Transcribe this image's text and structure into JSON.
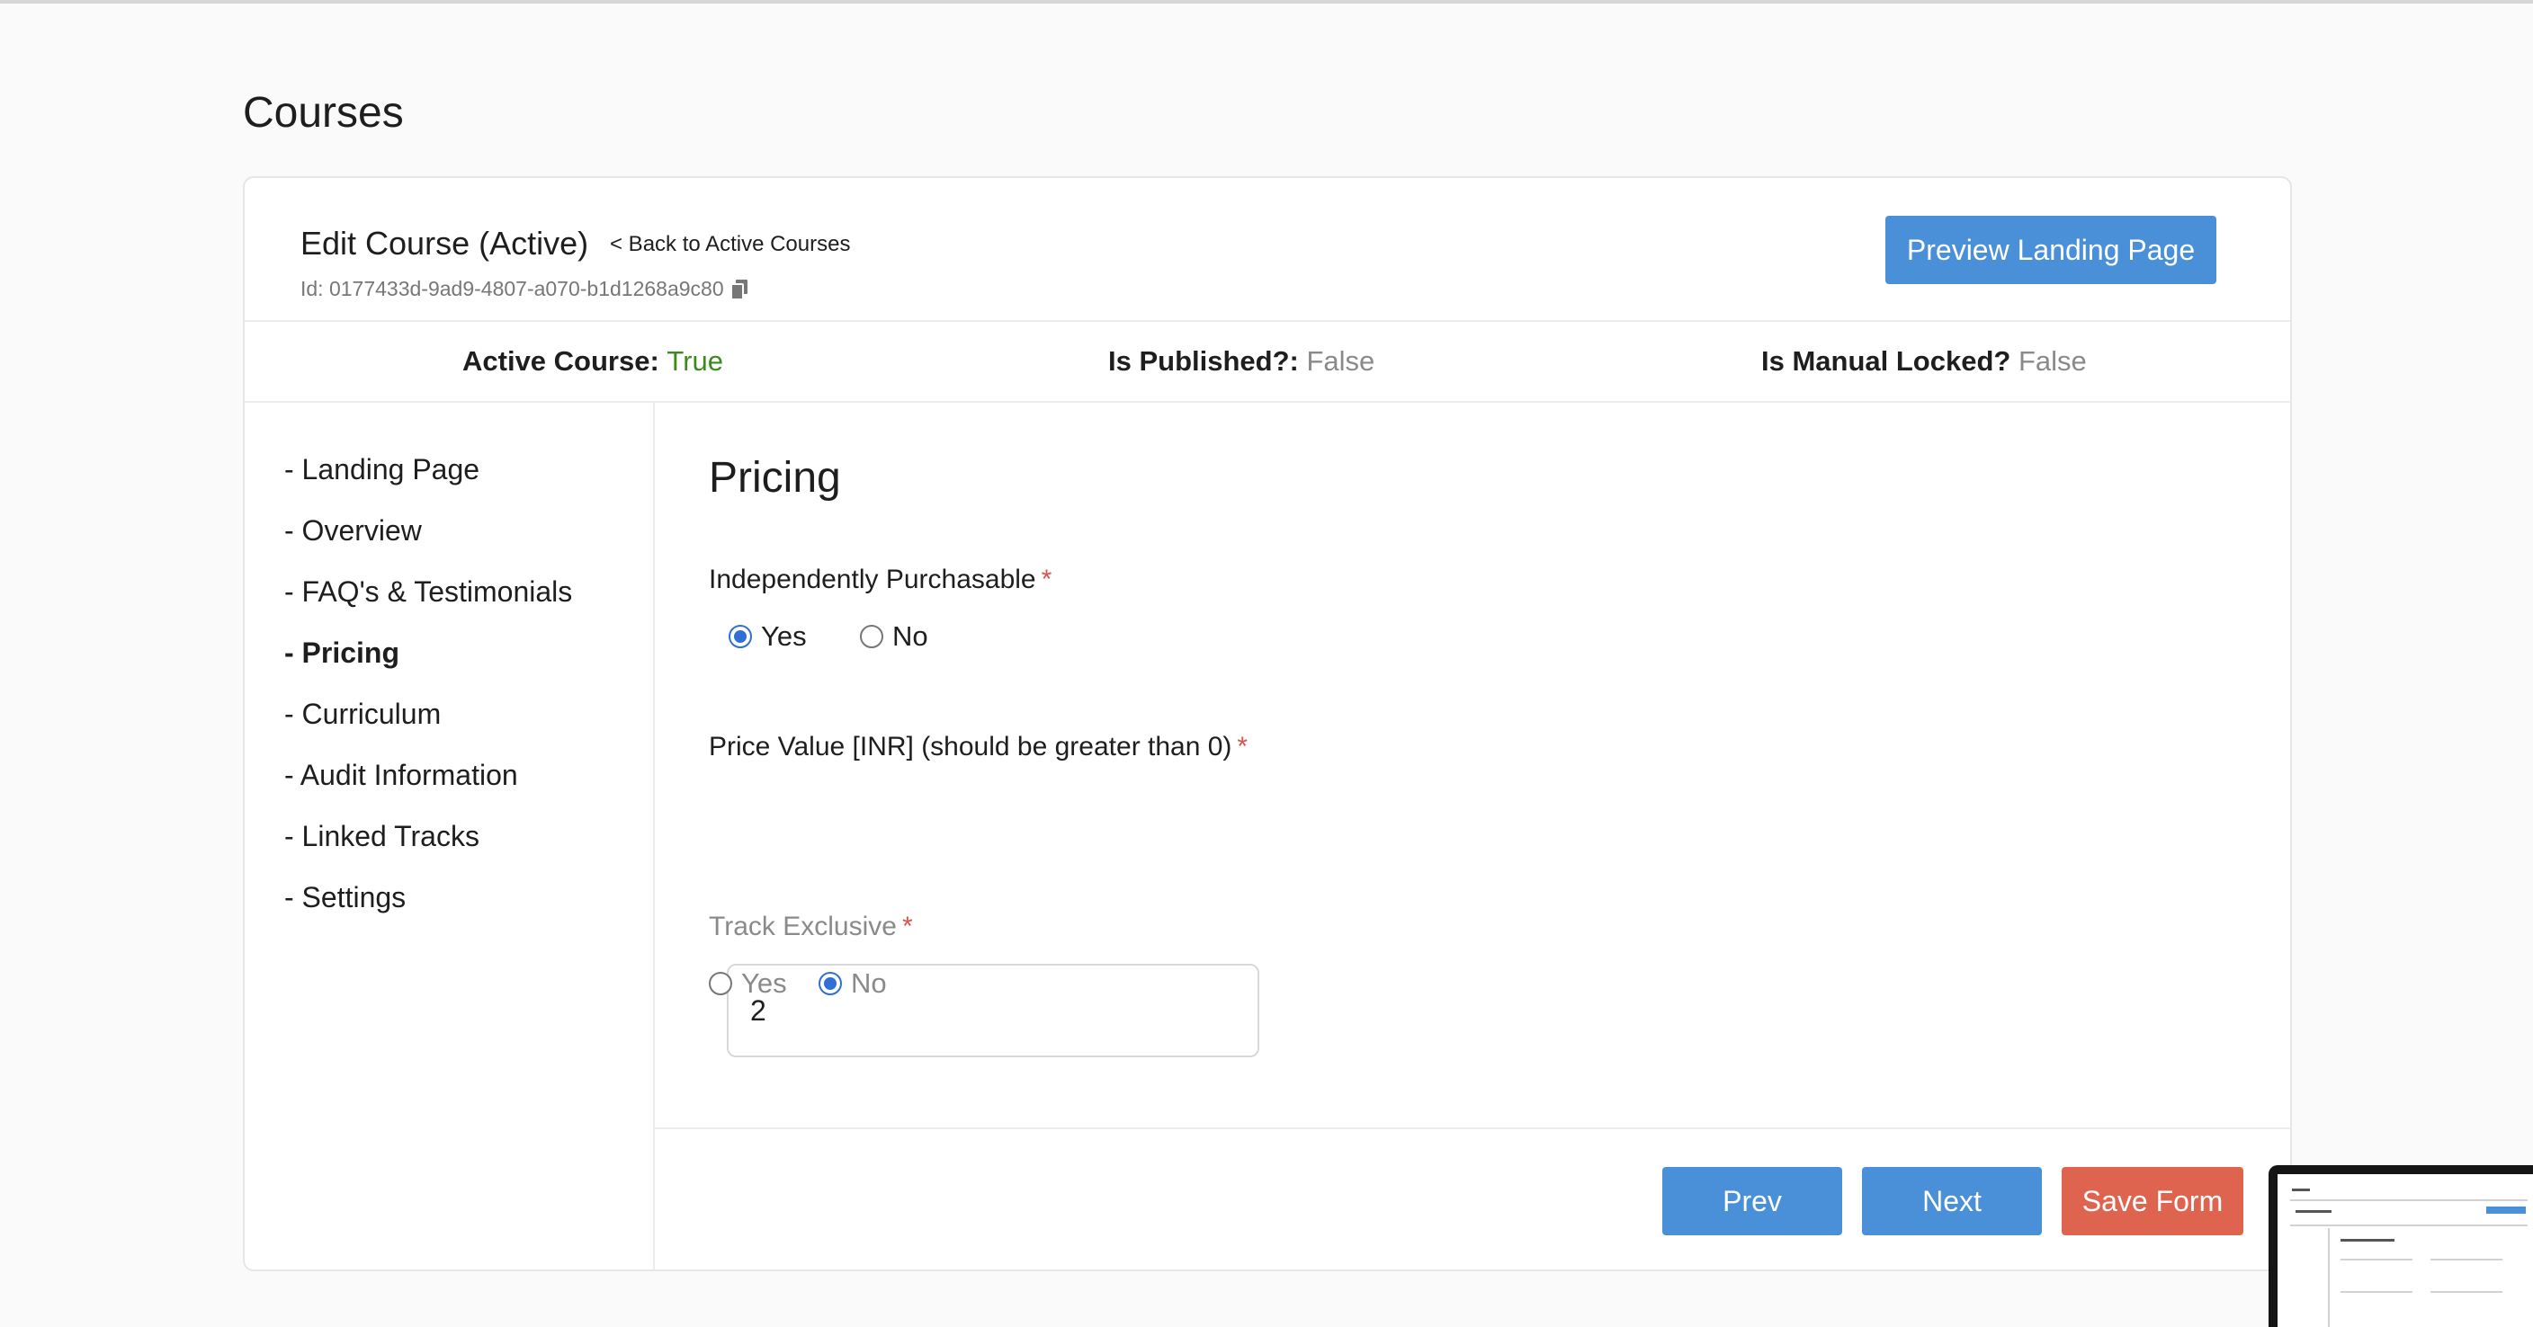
{
  "page": {
    "title": "Courses"
  },
  "header": {
    "edit_title": "Edit Course (Active)",
    "back_link": "< Back to Active Courses",
    "course_id": "Id: 0177433d-9ad9-4807-a070-b1d1268a9c80",
    "preview_button": "Preview Landing Page"
  },
  "status": {
    "active_label": "Active Course:",
    "active_value": "True",
    "published_label": "Is Published?:",
    "published_value": "False",
    "locked_label": "Is Manual Locked?",
    "locked_value": "False"
  },
  "sidebar": {
    "items": [
      {
        "label": "- Landing Page"
      },
      {
        "label": "- Overview"
      },
      {
        "label": "- FAQ's & Testimonials"
      },
      {
        "label": "- Pricing",
        "active": true
      },
      {
        "label": "- Curriculum"
      },
      {
        "label": "- Audit Information"
      },
      {
        "label": "- Linked Tracks"
      },
      {
        "label": "- Settings"
      }
    ]
  },
  "form": {
    "section_title": "Pricing",
    "independently_purchasable": {
      "label": "Independently Purchasable",
      "required_mark": "*",
      "options": [
        "Yes",
        "No"
      ],
      "selected": "Yes"
    },
    "price": {
      "label": "Price Value [INR] (should be greater than 0)",
      "required_mark": "*",
      "value": "2"
    },
    "track_exclusive": {
      "label": "Track Exclusive",
      "required_mark": "*",
      "options": [
        "Yes",
        "No"
      ],
      "selected": "No"
    }
  },
  "footer": {
    "prev": "Prev",
    "next": "Next",
    "save": "Save Form"
  },
  "colors": {
    "primary_button": "#4a90d9",
    "danger_button": "#de6450",
    "true_value": "#3a8a1e",
    "false_value": "#8a8a8a",
    "required": "#d9534f"
  },
  "icons": {
    "copy": "copy-icon"
  }
}
